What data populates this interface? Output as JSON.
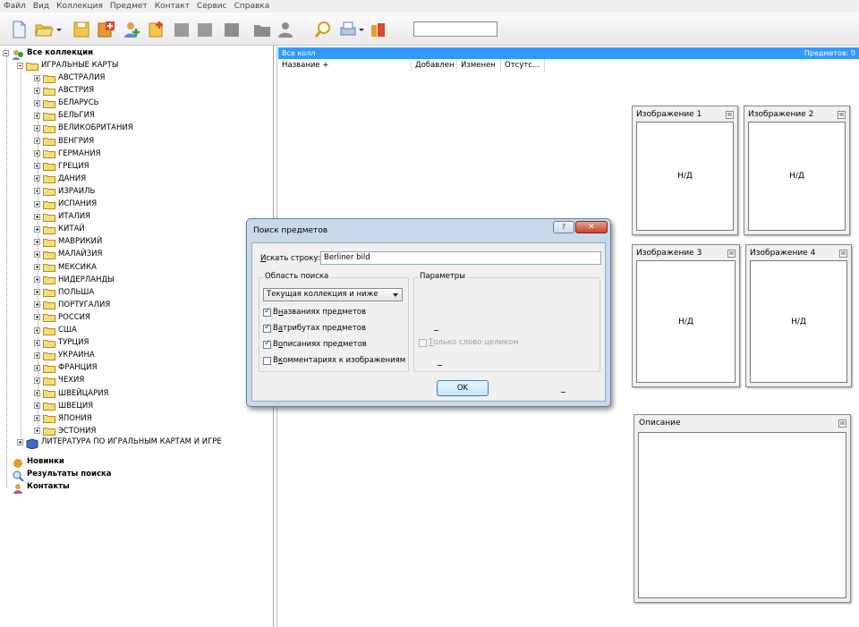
{
  "menu": [
    "Файл",
    "Вид",
    "Коллекция",
    "Предмет",
    "Контакт",
    "Сервис",
    "Справка"
  ],
  "toolbar": {
    "icons": [
      "new-document-icon",
      "open-folder-icon",
      "save-icon",
      "add-collection-icon",
      "add-item-icon",
      "add-icon",
      "book-icon",
      "book-gray-icon",
      "folder-gray-icon",
      "user-gray-icon",
      "search-icon",
      "print-icon",
      "export-icon"
    ],
    "search_value": ""
  },
  "tree": {
    "root": "Все коллекции",
    "collection": "ИГРАЛЬНЫЕ КАРТЫ",
    "countries": [
      "АВСТРАЛИЯ",
      "АВСТРИЯ",
      "БЕЛАРУСЬ",
      "БЕЛЬГИЯ",
      "ВЕЛИКОБРИТАНИЯ",
      "ВЕНГРИЯ",
      "ГЕРМАНИЯ",
      "ГРЕЦИЯ",
      "ДАНИЯ",
      "ИЗРАИЛЬ",
      "ИСПАНИЯ",
      "ИТАЛИЯ",
      "КИТАЙ",
      "МАВРИКИЙ",
      "МАЛАЙЗИЯ",
      "МЕКСИКА",
      "НИДЕРЛАНДЫ",
      "ПОЛЬША",
      "ПОРТУГАЛИЯ",
      "РОССИЯ",
      "США",
      "ТУРЦИЯ",
      "УКРАИНА",
      "ФРАНЦИЯ",
      "ЧЕХИЯ",
      "ШВЕЙЦАРИЯ",
      "ШВЕЦИЯ",
      "ЯПОНИЯ",
      "ЭСТОНИЯ"
    ],
    "literature": "ЛИТЕРАТУРА ПО ИГРАЛЬНЫМ КАРТАМ И ИГРЕ",
    "extras": [
      "Новинки",
      "Результаты поиска",
      "Контакты"
    ]
  },
  "list": {
    "header_left": "Все колл",
    "header_right": "Предметов: 0",
    "columns": [
      "Название +",
      "Добавлен",
      "Изменен",
      "Отсутс..."
    ]
  },
  "images": [
    {
      "title": "Изображение 1",
      "value": "Н/Д"
    },
    {
      "title": "Изображение 2",
      "value": "Н/Д"
    },
    {
      "title": "Изображение 3",
      "value": "Н/Д"
    },
    {
      "title": "Изображение 4",
      "value": "Н/Д"
    }
  ],
  "description": {
    "title": "Описание"
  },
  "close_glyph": "⊠",
  "dialog": {
    "title": "Поиск предметов",
    "help": "?",
    "close": "✕",
    "search_label_u": "И",
    "search_label_rest": "скать строку:",
    "search_value": "Berliner bild",
    "area_title": "Область поиска",
    "area_option": "Текущая коллекция и ниже",
    "params_title": "Параметры",
    "cb1_pre": "В ",
    "cb1_u": "н",
    "cb1_post": "азваниях предметов",
    "cb2_pre": "В ",
    "cb2_u": "а",
    "cb2_post": "трибутах предметов",
    "cb3_pre": "В ",
    "cb3_u": "о",
    "cb3_post": "писаниях предметов",
    "cb4_pre": "В ",
    "cb4_u": "к",
    "cb4_post": "омментариях к изображениям",
    "cb5_u": "Т",
    "cb5_post": "олько слово целиком",
    "ok": "OK"
  }
}
